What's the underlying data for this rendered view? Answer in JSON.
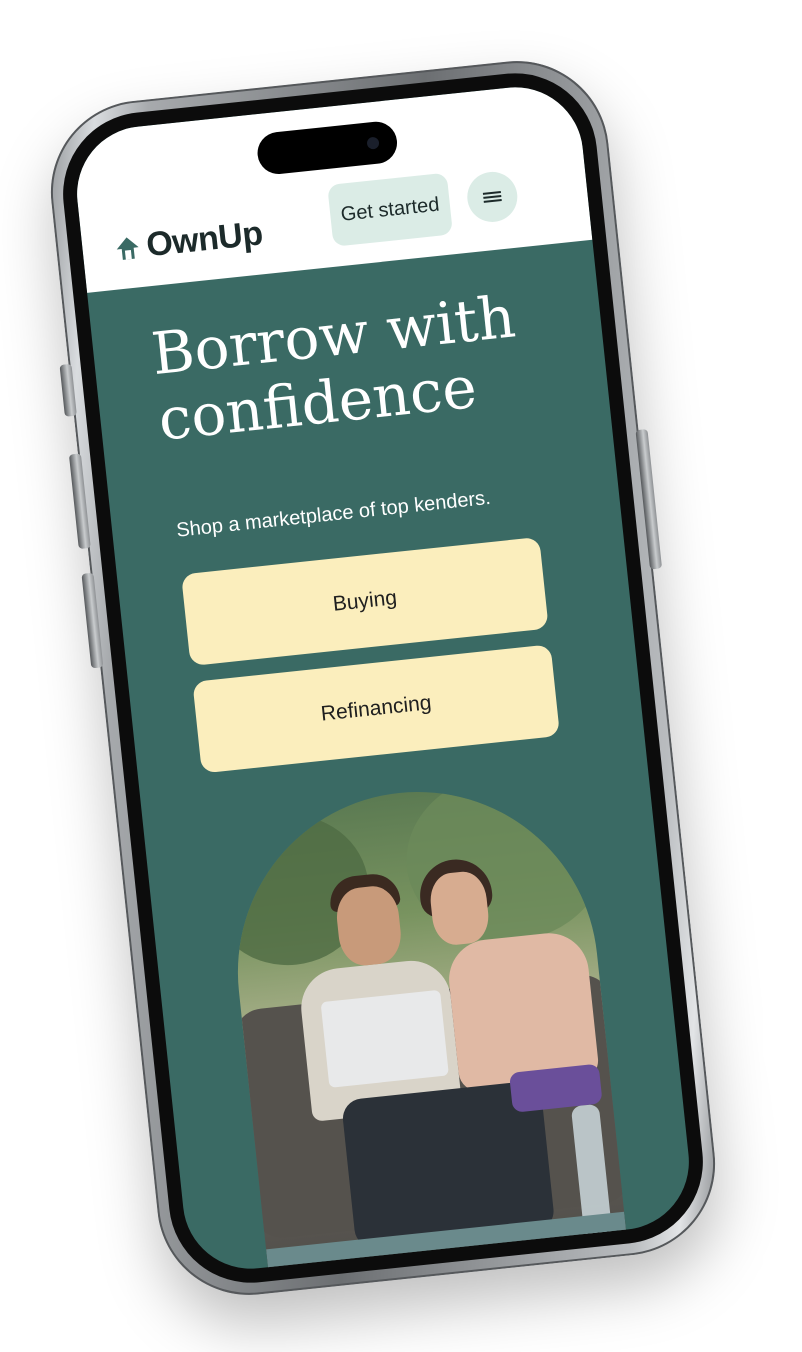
{
  "app": {
    "brand": "OwnUp"
  },
  "header": {
    "get_started_label": "Get started",
    "menu_icon": "hamburger-menu-icon",
    "logo_icon": "house-arrow-icon"
  },
  "hero": {
    "title": "Borrow with confidence",
    "subtitle": "Shop a marketplace of top kenders."
  },
  "actions": {
    "buying_label": "Buying",
    "refinancing_label": "Refinancing"
  },
  "colors": {
    "primary_green": "#3a6a64",
    "cta_yellow": "#fbeebd",
    "pill_mint": "#dbece6"
  }
}
